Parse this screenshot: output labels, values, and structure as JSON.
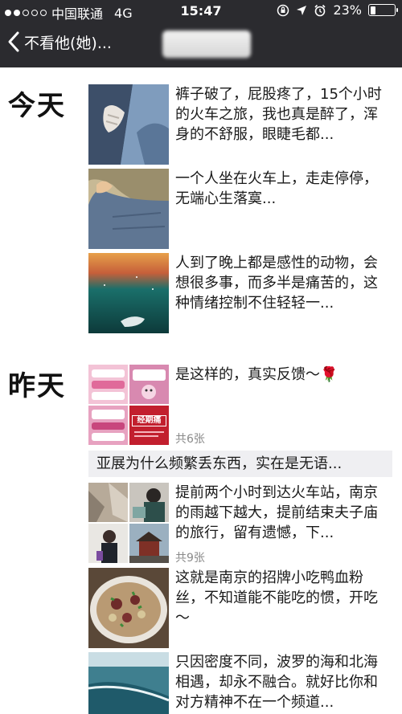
{
  "status": {
    "carrier": "中国联通",
    "network": "4G",
    "time": "15:47",
    "battery": "23%",
    "battery_level": 0.23,
    "signal_dots_filled": 2,
    "signal_dots_total": 5
  },
  "nav": {
    "back_label": "不看他(她)..."
  },
  "sections": {
    "today_label": "今天",
    "yesterday_label": "昨天"
  },
  "posts": {
    "p1": {
      "text": "裤子破了，屁股疼了，15个小时的火车之旅，我也真是醉了，浑身的不舒服，眼睫毛都..."
    },
    "p2": {
      "text": "一个人坐在火车上，走走停停，无端心生落寞..."
    },
    "p3": {
      "text": "人到了晚上都是感性的动物，会想很多事，而多半是痛苦的，这种情绪控制不住轻轻一..."
    },
    "p4": {
      "text": "是这样的，真实反馈～🌹",
      "count": "共6张",
      "image_caption": "经期痛"
    },
    "share": {
      "text": "亚展为什么频繁丢东西，实在是无语..."
    },
    "p5": {
      "text": "提前两个小时到达火车站，南京的雨越下越大，提前结束夫子庙的旅行，留有遗憾，下...",
      "count": "共9张"
    },
    "p6": {
      "text": "这就是南京的招牌小吃鸭血粉丝，不知道能不能吃的惯，开吃～"
    },
    "p7": {
      "text": "只因密度不同，波罗的海和北海相遇，却永不融合。就好比你和对方精神不在一个频道..."
    }
  },
  "colors": {
    "topbar": "#2b2b2f",
    "share_bg": "#efeff2",
    "count_text": "#8a8a8a"
  }
}
